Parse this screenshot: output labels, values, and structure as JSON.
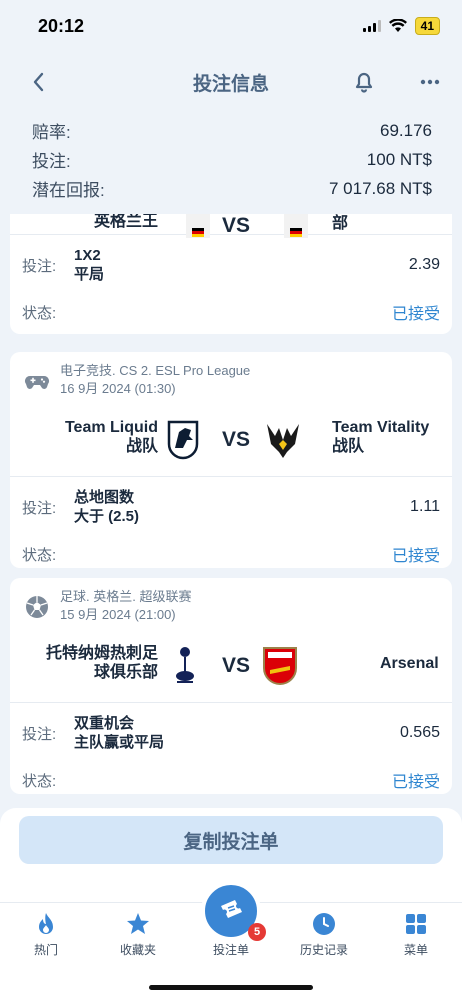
{
  "status_bar": {
    "time": "20:12",
    "battery": "41"
  },
  "nav": {
    "title": "投注信息"
  },
  "summary": [
    {
      "label": "赔率:",
      "value": "69.176"
    },
    {
      "label": "投注:",
      "value": "100 NT$"
    },
    {
      "label": "潜在回报:",
      "value": "7 017.68 NT$"
    }
  ],
  "card0": {
    "home_team_partial": "英格兰王",
    "away_team_partial": "部",
    "vs": "VS",
    "bet_label": "投注:",
    "bet_line1": "1X2",
    "bet_line2": "平局",
    "odds": "2.39",
    "status_label": "状态:",
    "status": "已接受"
  },
  "card1": {
    "sport_icon": "gamepad-icon",
    "league": "电子竞技. CS 2. ESL Pro League",
    "date": "16 9月 2024 (01:30)",
    "home_line1": "Team Liquid",
    "home_line2": "战队",
    "away_line1": "Team Vitality",
    "away_line2": "战队",
    "vs": "VS",
    "bet_label": "投注:",
    "bet_line1": "总地图数",
    "bet_line2": "大于 (2.5)",
    "odds": "1.11",
    "status_label": "状态:",
    "status": "已接受"
  },
  "card2": {
    "sport_icon": "soccer-ball-icon",
    "league": "足球. 英格兰. 超级联赛",
    "date": "15 9月 2024 (21:00)",
    "home_line1": "托特纳姆热刺足",
    "home_line2": "球俱乐部",
    "away_line1": "Arsenal",
    "vs": "VS",
    "bet_label": "投注:",
    "bet_line1": "双重机会",
    "bet_line2": "主队赢或平局",
    "odds": "0.565",
    "status_label": "状态:",
    "status": "已接受"
  },
  "copy_button": "复制投注单",
  "tabs": [
    {
      "label": "热门",
      "icon": "fire-icon"
    },
    {
      "label": "收藏夹",
      "icon": "star-icon"
    },
    {
      "label": "投注单",
      "icon": "ticket-icon",
      "badge": "5"
    },
    {
      "label": "历史记录",
      "icon": "clock-icon"
    },
    {
      "label": "菜单",
      "icon": "grid-icon"
    }
  ],
  "colors": {
    "accent": "#3a86d4",
    "status": "#2f86d0",
    "background": "#eef3f9"
  }
}
